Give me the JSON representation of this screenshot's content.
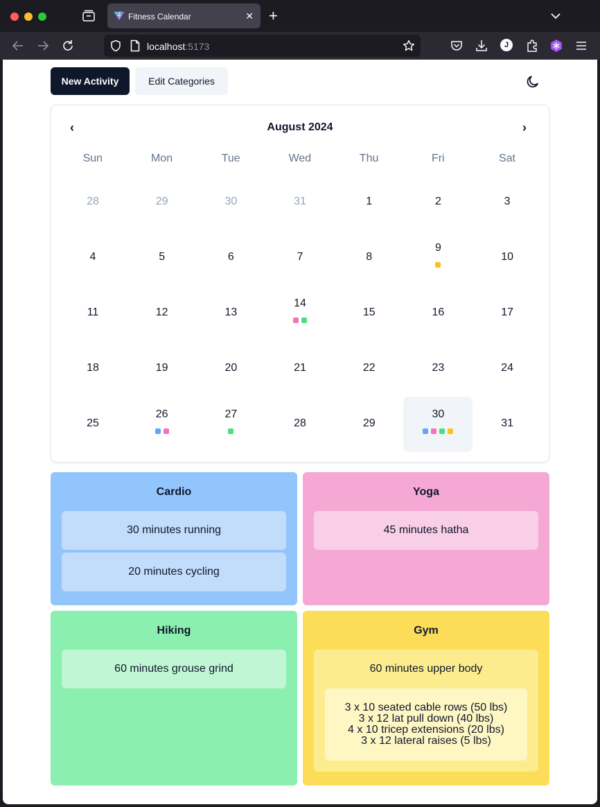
{
  "browser": {
    "tab_title": "Fitness Calendar",
    "url_host": "localhost",
    "url_port": ":5173",
    "profile_initial": "J"
  },
  "toolbar": {
    "new_activity_label": "New Activity",
    "edit_categories_label": "Edit Categories"
  },
  "calendar": {
    "month_title": "August 2024",
    "prev_label": "‹",
    "next_label": "›",
    "weekdays": [
      "Sun",
      "Mon",
      "Tue",
      "Wed",
      "Thu",
      "Fri",
      "Sat"
    ],
    "weeks": [
      [
        {
          "n": "28",
          "outside": true
        },
        {
          "n": "29",
          "outside": true
        },
        {
          "n": "30",
          "outside": true
        },
        {
          "n": "31",
          "outside": true
        },
        {
          "n": "1"
        },
        {
          "n": "2"
        },
        {
          "n": "3"
        }
      ],
      [
        {
          "n": "4"
        },
        {
          "n": "5"
        },
        {
          "n": "6"
        },
        {
          "n": "7"
        },
        {
          "n": "8"
        },
        {
          "n": "9",
          "dots": [
            "gym"
          ]
        },
        {
          "n": "10"
        }
      ],
      [
        {
          "n": "11"
        },
        {
          "n": "12"
        },
        {
          "n": "13"
        },
        {
          "n": "14",
          "dots": [
            "yoga",
            "hiking"
          ]
        },
        {
          "n": "15"
        },
        {
          "n": "16"
        },
        {
          "n": "17"
        }
      ],
      [
        {
          "n": "18"
        },
        {
          "n": "19"
        },
        {
          "n": "20"
        },
        {
          "n": "21"
        },
        {
          "n": "22"
        },
        {
          "n": "23"
        },
        {
          "n": "24"
        }
      ],
      [
        {
          "n": "25"
        },
        {
          "n": "26",
          "dots": [
            "cardio",
            "yoga"
          ]
        },
        {
          "n": "27",
          "dots": [
            "hiking"
          ]
        },
        {
          "n": "28"
        },
        {
          "n": "29"
        },
        {
          "n": "30",
          "selected": true,
          "dots": [
            "cardio",
            "yoga",
            "hiking",
            "gym"
          ]
        },
        {
          "n": "31"
        }
      ]
    ]
  },
  "colors": {
    "cardio": "#60a5fa",
    "yoga": "#f472b6",
    "hiking": "#4ade80",
    "gym": "#fbbf24",
    "cardio_bg": "#93c5fd",
    "yoga_bg": "#f5a8d4",
    "hiking_bg": "#8aefaf",
    "gym_bg": "#fcdd58",
    "cardio_item": "#c2dcfb",
    "yoga_item": "#f8cfe6",
    "hiking_item": "#c0f6d3",
    "gym_item": "#fdec8e",
    "gym_detail": "#fef6c3"
  },
  "categories": {
    "cardio": {
      "title": "Cardio",
      "activities": [
        "30 minutes running",
        "20 minutes cycling"
      ]
    },
    "yoga": {
      "title": "Yoga",
      "activities": [
        "45 minutes hatha"
      ]
    },
    "hiking": {
      "title": "Hiking",
      "activities": [
        "60 minutes grouse grind"
      ]
    },
    "gym": {
      "title": "Gym",
      "activity": "60 minutes upper body",
      "details": [
        "3 x 10 seated cable rows (50 lbs)",
        "3 x 12 lat pull down (40 lbs)",
        "4 x 10 tricep extensions (20 lbs)",
        "3 x 12 lateral raises (5 lbs)"
      ]
    }
  }
}
